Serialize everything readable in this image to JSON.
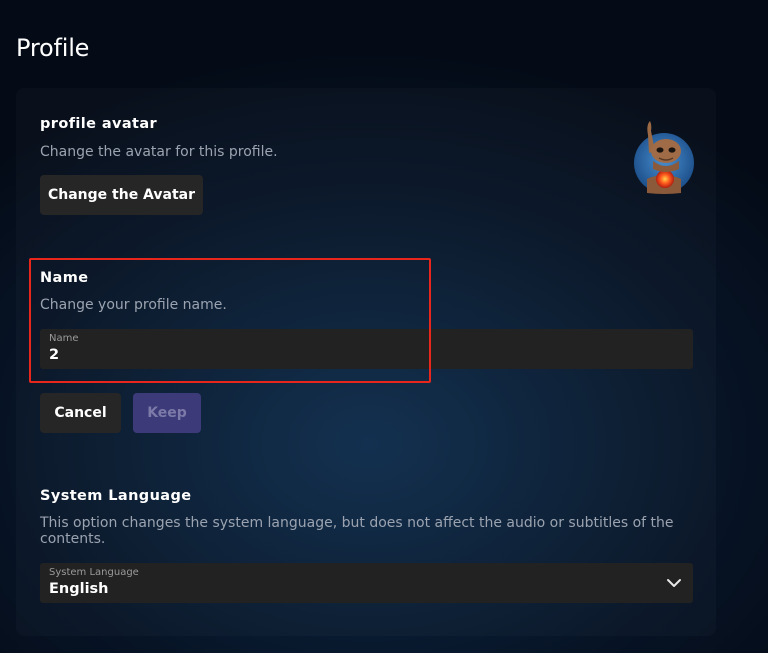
{
  "page": {
    "title": "Profile"
  },
  "avatar_section": {
    "title": "profile avatar",
    "description": "Change the avatar for this profile.",
    "change_button": "Change the Avatar",
    "avatar_icon": "alien-character-avatar"
  },
  "name_section": {
    "title": "Name",
    "description": "Change your profile name.",
    "field_label": "Name",
    "field_value": "2",
    "cancel_button": "Cancel",
    "keep_button": "Keep"
  },
  "language_section": {
    "title": "System Language",
    "description": "This option changes the system language, but does not affect the audio or subtitles of the contents.",
    "select_label": "System Language",
    "select_value": "English",
    "select_icon": "chevron-down-icon"
  },
  "colors": {
    "highlight": "#e8261c",
    "keep_button_bg": "#3c3a78",
    "button_bg": "#262626"
  }
}
